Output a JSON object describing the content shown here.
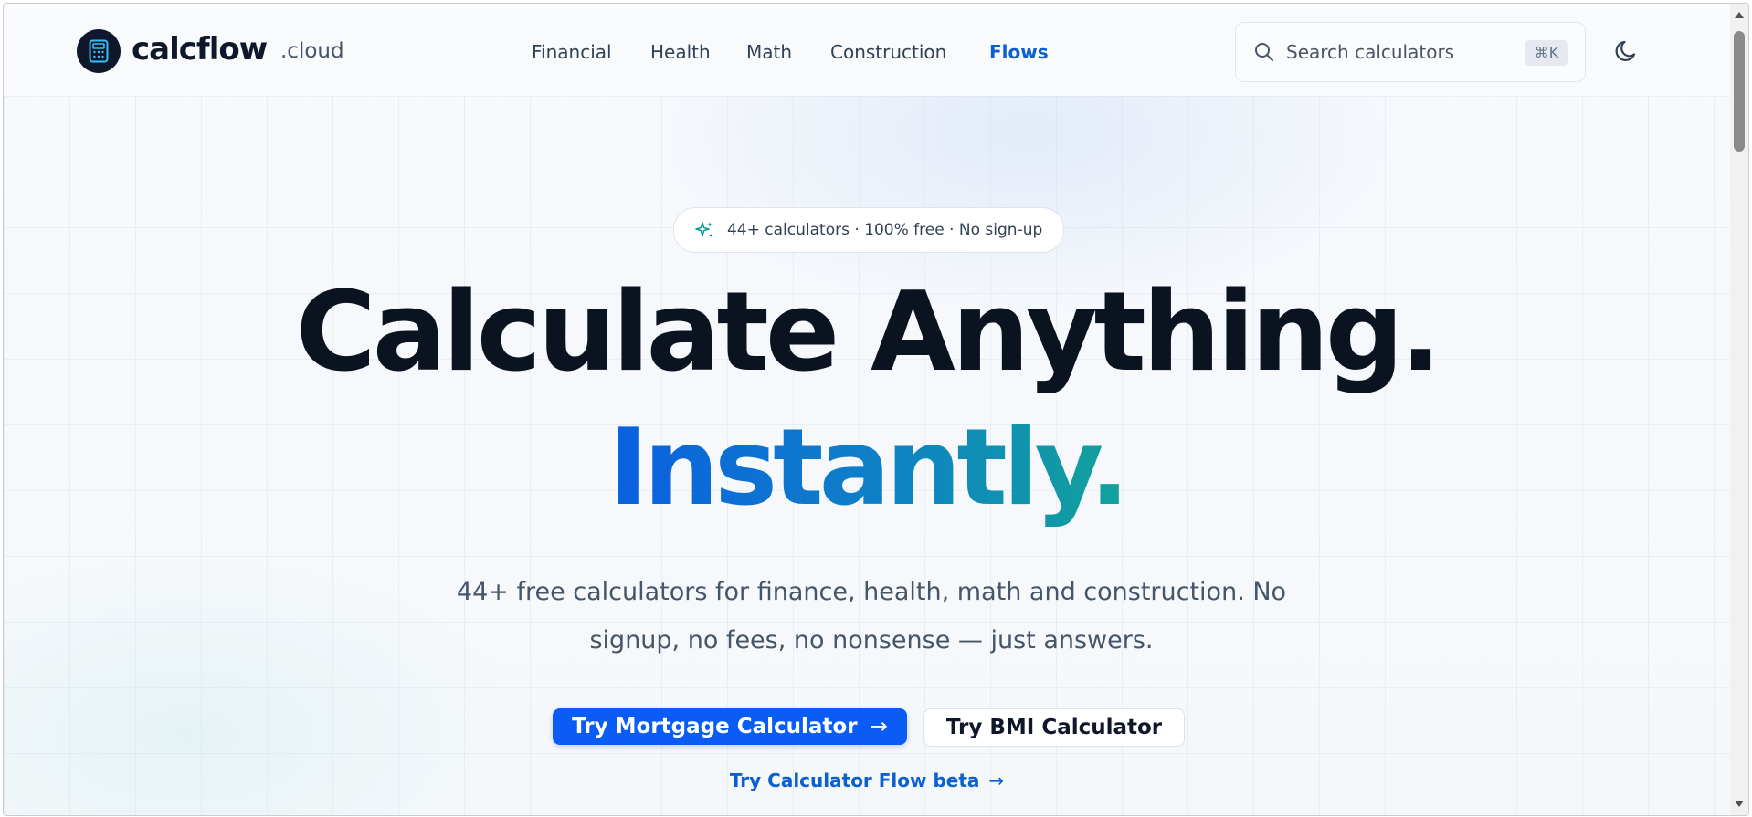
{
  "brand": {
    "name": "calcflow",
    "suffix": ".cloud"
  },
  "nav": {
    "items": [
      {
        "label": "Financial",
        "active": false
      },
      {
        "label": "Health",
        "active": false
      },
      {
        "label": "Math",
        "active": false
      },
      {
        "label": "Construction",
        "active": false
      },
      {
        "label": "Flows",
        "active": true
      }
    ]
  },
  "search": {
    "placeholder": "Search calculators",
    "shortcut": "⌘K"
  },
  "hero": {
    "badge": "44+ calculators · 100% free · No sign-up",
    "headline_line1": "Calculate Anything.",
    "headline_line2": "Instantly.",
    "subheading": "44+ free calculators for finance, health, math and construction. No signup, no fees, no nonsense — just answers.",
    "primary_cta": "Try Mortgage Calculator",
    "secondary_cta": "Try BMI Calculator",
    "flow_link": "Try Calculator Flow beta"
  },
  "colors": {
    "accent": "#0a5cf5",
    "link": "#0b5fd1",
    "gradient_end": "#12a29a",
    "ink": "#0f172a"
  },
  "icons": [
    "calculator-icon",
    "search-icon",
    "moon-icon",
    "sparkles-icon",
    "arrow-right-icon",
    "scrollbar-arrow-up-icon",
    "scrollbar-arrow-down-icon"
  ]
}
